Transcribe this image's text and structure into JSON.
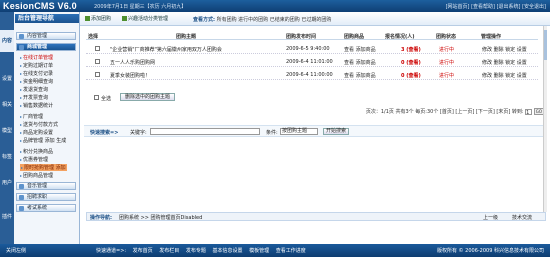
{
  "header": {
    "logo": "KesionCMS V6.0",
    "date": "2009年7月1日 星期三【农历 六月初九】",
    "links": "[网站首页] [查看帮助] [退出系统] [安全退出]"
  },
  "sidebar": {
    "title": "后台管理导航",
    "vtabs": [
      "内容",
      "设置",
      "相关",
      "模型",
      "标签",
      "用户",
      "插件"
    ],
    "groups": [
      {
        "label": "内容管理"
      },
      {
        "label": "商城管理"
      },
      {
        "label": "音乐管理"
      },
      {
        "label": "招聘求职"
      },
      {
        "label": "考试系统"
      }
    ],
    "items": [
      "在线订单管理",
      "定购过期订单",
      "在线支付记录",
      "资金明细查询",
      "发退货查询",
      "开发票查询",
      "销售数据统计",
      "厂商管理",
      "送货与付款方式",
      "商品定购设置",
      "品牌管理 添加 生成",
      "积分兑换商品",
      "优惠券管理",
      "限时抢购管理 添加",
      "团购商品管理"
    ]
  },
  "toolbar": {
    "add_label": "添加团购",
    "manage_label": "兴趣活动分类管理",
    "view_prefix": "查看方式:",
    "view_options": "所有团购 进行中的团购 已结束的团购 已过期的团购"
  },
  "table": {
    "headers": [
      "选择",
      "团购主题",
      "团购发布时间",
      "团购商品",
      "报名情况(人)",
      "团购状态",
      "管理操作"
    ],
    "rows": [
      {
        "title": "\"企业营销\"厂商推荐\"第六届徽州家用双万人团购会",
        "time": "2009-6-5 9:40:00",
        "goods": "查看 添加商品",
        "count": "3 (查看)",
        "status": "进行中",
        "ops": "修改 删除 锁定 设置"
      },
      {
        "title": "五一人人乐购团购网",
        "time": "2009-6-4 11:01:00",
        "goods": "查看 添加商品",
        "count": "0 (查看)",
        "status": "进行中",
        "ops": "修改 删除 锁定 设置"
      },
      {
        "title": "夏季女装团购啦！",
        "time": "2009-6-4 11:00:00",
        "goods": "查看 添加商品",
        "count": "0 (查看)",
        "status": "进行中",
        "ops": "修改 删除 锁定 设置"
      }
    ],
    "select_all": "全选",
    "delete_button": "删除选中的团购主题"
  },
  "pager": {
    "text": "页次：1/1页 共有3个 每页:30个 [首页] [上一页] [下一页] [末页] 转到:",
    "input": "1",
    "go": "GO"
  },
  "search": {
    "label": "快速搜索=>",
    "keyword_label": "关键字:",
    "condition_label": "条件:",
    "select_value": "按团购主题",
    "button": "开始搜索"
  },
  "opbar": {
    "label": "操作导航:",
    "path": "团购系统 >> 团购管理首页Disabled",
    "back": "上一级",
    "tech": "技术交流"
  },
  "footer": {
    "left": "关闭左侧",
    "nav": [
      "快速通道=>:",
      "发布首页",
      "发布栏目",
      "发布专题",
      "基本信息设置",
      "模板管理",
      "查看工作进度"
    ],
    "copyright": "版权所有 © 2006-2009 科兴信息技术有限公司"
  }
}
